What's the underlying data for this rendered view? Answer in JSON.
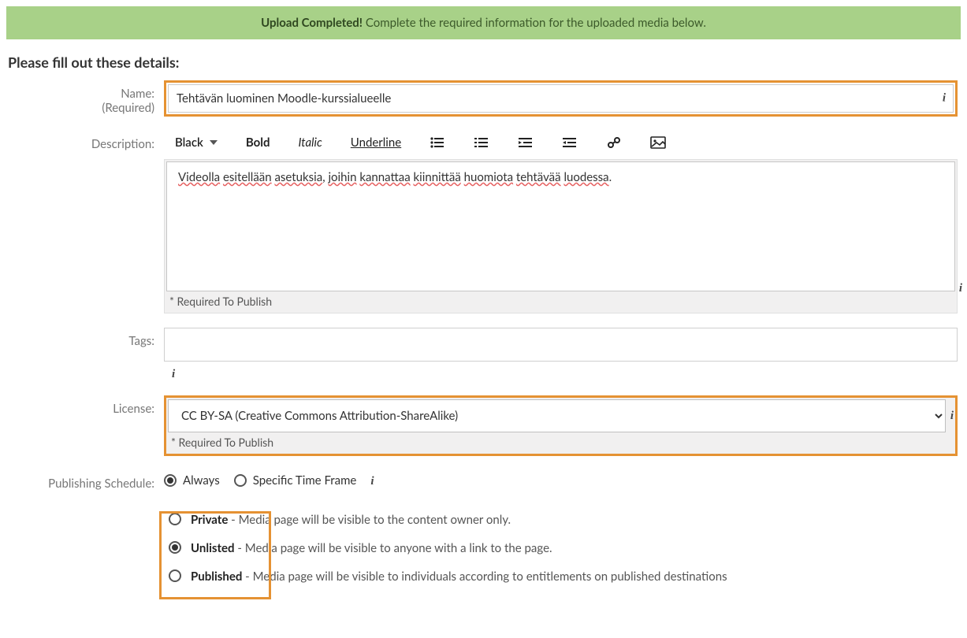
{
  "banner": {
    "strong": "Upload Completed!",
    "rest": " Complete the required information for the uploaded media below."
  },
  "heading": "Please fill out these details:",
  "labels": {
    "name": "Name:",
    "name_req": "(Required)",
    "description": "Description:",
    "tags": "Tags:",
    "license": "License:",
    "publishing": "Publishing Schedule:"
  },
  "fields": {
    "name_value": "Tehtävän luominen Moodle-kurssialueelle",
    "description_value_words": [
      "Videolla",
      "esitellään",
      "asetuksia",
      ",",
      "joihin",
      "kannattaa",
      "kiinnittää",
      "huomiota",
      "tehtävää",
      "luodessa",
      "."
    ],
    "tags_value": "",
    "license_value": "CC BY-SA (Creative Commons Attribution-ShareAlike)"
  },
  "toolbar": {
    "color": "Black",
    "bold": "Bold",
    "italic": "Italic",
    "underline": "Underline"
  },
  "notes": {
    "required_publish": "* Required To Publish"
  },
  "publishing": {
    "always": "Always",
    "specific": "Specific Time Frame",
    "selected": "always"
  },
  "visibility": {
    "options": [
      {
        "key": "private",
        "label": "Private",
        "desc": " - Media page will be visible to the content owner only."
      },
      {
        "key": "unlisted",
        "label": "Unlisted",
        "desc": " - Media page will be visible to anyone with a link to the page."
      },
      {
        "key": "published",
        "label": "Published",
        "desc": " - Media page will be visible to individuals according to entitlements on published destinations"
      }
    ],
    "selected": "unlisted"
  },
  "icons": {
    "info": "i"
  }
}
